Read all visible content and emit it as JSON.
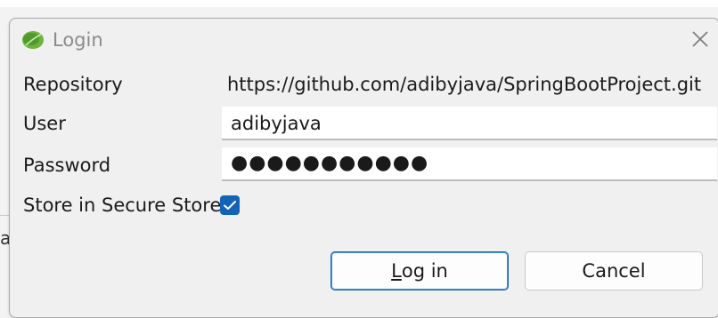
{
  "dialog": {
    "title": "Login",
    "close_label": "close"
  },
  "form": {
    "repository_label": "Repository",
    "repository_value": "https://github.com/adibyjava/SpringBootProject.git",
    "user_label": "User",
    "user_value": "adibyjava",
    "password_label": "Password",
    "password_value": "●●●●●●●●●●●",
    "store_label": "Store in Secure Store",
    "store_checked": true
  },
  "buttons": {
    "login_mnemonic": "L",
    "login_rest": "og in",
    "cancel_label": "Cancel"
  },
  "background": {
    "partial_char": "a"
  },
  "colors": {
    "accent": "#1463b8",
    "app_icon": "#4e9a2a",
    "dialog_bg": "#f0f0f0"
  },
  "icons": {
    "app": "spring-leaf-icon",
    "close": "close-icon",
    "check": "checkmark-icon"
  }
}
